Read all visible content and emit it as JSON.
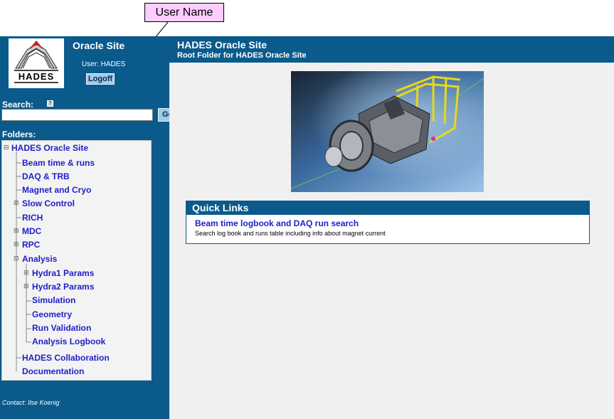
{
  "annotation": {
    "callout_label": "User Name"
  },
  "sidebar": {
    "site_name": "Oracle Site",
    "logo_text": "HADES",
    "user_label": "User: HADES",
    "logoff_label": "Logoff",
    "search": {
      "label": "Search:",
      "value": "",
      "go_label": "Go",
      "help_icon": "help-icon"
    },
    "folders_label": "Folders:",
    "tree": [
      {
        "label": "HADES Oracle Site",
        "toggle": "⊟"
      },
      {
        "label": "Beam time & runs",
        "toggle": ""
      },
      {
        "label": "DAQ & TRB",
        "toggle": ""
      },
      {
        "label": "Magnet and Cryo",
        "toggle": ""
      },
      {
        "label": "Slow Control",
        "toggle": "⊞"
      },
      {
        "label": "RICH",
        "toggle": ""
      },
      {
        "label": "MDC",
        "toggle": "⊞"
      },
      {
        "label": "RPC",
        "toggle": "⊞"
      },
      {
        "label": "Analysis",
        "toggle": "⊟"
      },
      {
        "label": "Hydra1 Params",
        "toggle": "⊞"
      },
      {
        "label": "Hydra2 Params",
        "toggle": "⊞"
      },
      {
        "label": "Simulation",
        "toggle": ""
      },
      {
        "label": "Geometry",
        "toggle": ""
      },
      {
        "label": "Run Validation",
        "toggle": ""
      },
      {
        "label": "Analysis Logbook",
        "toggle": ""
      },
      {
        "label": "HADES Collaboration",
        "toggle": ""
      },
      {
        "label": "Documentation",
        "toggle": ""
      }
    ],
    "contact": "Contact: Ilse Koenig"
  },
  "header": {
    "title": "HADES Oracle Site",
    "subtitle": "Root Folder for HADES Oracle Site"
  },
  "quick_links": {
    "heading": "Quick Links",
    "items": [
      {
        "title": "Beam time logbook and DAQ run search",
        "description": "Search log book and runs table including info about magnet current"
      }
    ]
  },
  "colors": {
    "brand_blue": "#0a5a8c",
    "link_blue": "#1e1ec8",
    "callout_pink": "#ffccff"
  }
}
